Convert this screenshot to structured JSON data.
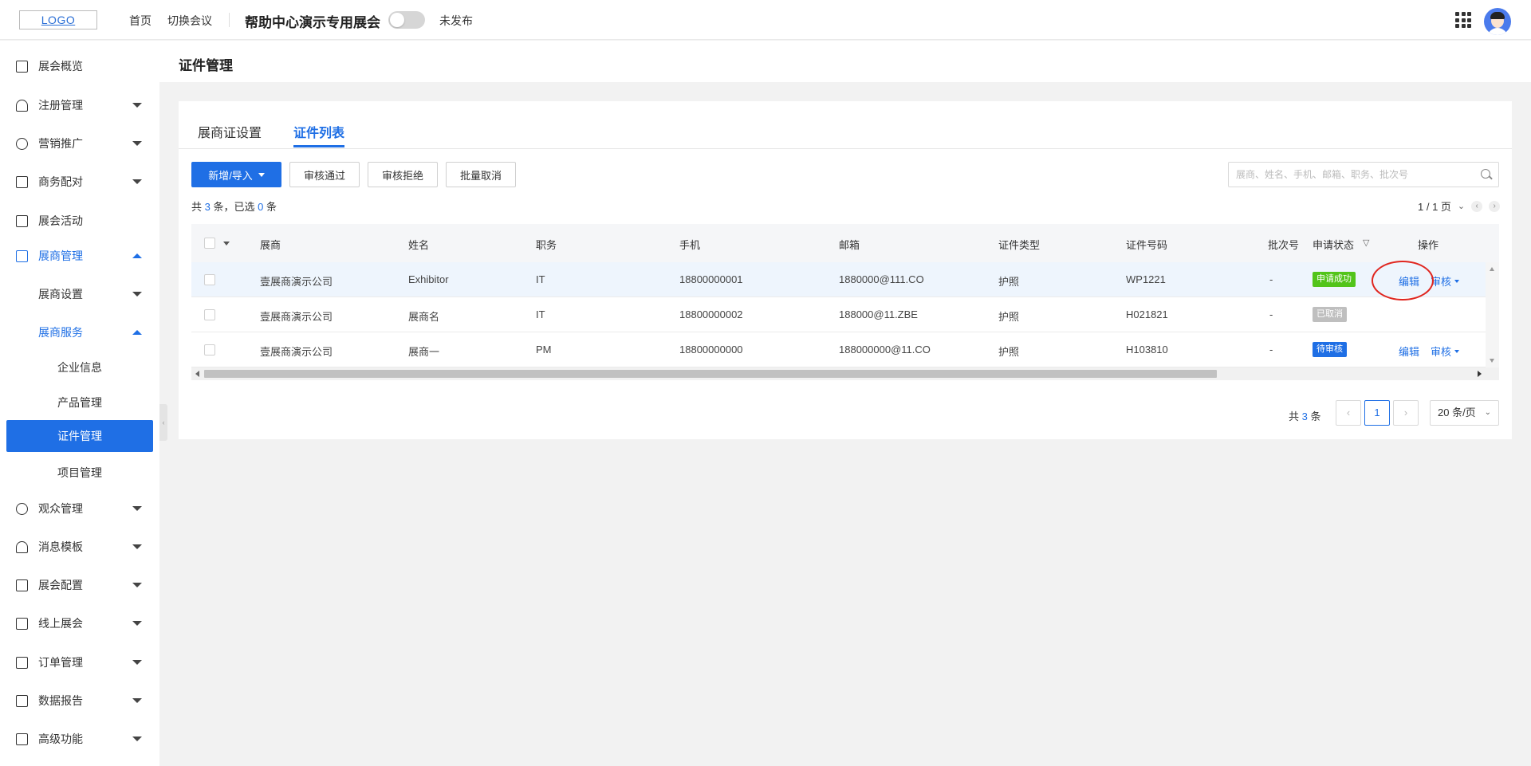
{
  "topbar": {
    "logo": "LOGO",
    "nav_home": "首页",
    "nav_switch": "切换会议",
    "expo_title": "帮助中心演示专用展会",
    "publish_status": "未发布"
  },
  "sidebar": {
    "items": [
      {
        "label": "展会概览"
      },
      {
        "label": "注册管理"
      },
      {
        "label": "营销推广"
      },
      {
        "label": "商务配对"
      },
      {
        "label": "展会活动"
      },
      {
        "label": "展商管理"
      },
      {
        "label": "展商设置"
      },
      {
        "label": "展商服务"
      },
      {
        "label": "企业信息"
      },
      {
        "label": "产品管理"
      },
      {
        "label": "证件管理"
      },
      {
        "label": "项目管理"
      },
      {
        "label": "观众管理"
      },
      {
        "label": "消息模板"
      },
      {
        "label": "展会配置"
      },
      {
        "label": "线上展会"
      },
      {
        "label": "订单管理"
      },
      {
        "label": "数据报告"
      },
      {
        "label": "高级功能"
      }
    ]
  },
  "page": {
    "title": "证件管理",
    "tabs": [
      {
        "label": "展商证设置"
      },
      {
        "label": "证件列表"
      }
    ]
  },
  "toolbar": {
    "add_import": "新增/导入",
    "approve": "审核通过",
    "reject": "审核拒绝",
    "batch_cancel": "批量取消",
    "search_placeholder": "展商、姓名、手机、邮箱、职务、批次号"
  },
  "summary": {
    "prefix": "共",
    "total": "3",
    "mid": "条，已选",
    "selected": "0",
    "suffix": "条",
    "mini_pager": "1 / 1 页"
  },
  "table": {
    "columns": [
      "展商",
      "姓名",
      "职务",
      "手机",
      "邮箱",
      "证件类型",
      "证件号码",
      "批次号",
      "申请状态",
      "操作"
    ],
    "rows": [
      {
        "exhibitor": "壹展商演示公司",
        "name": "Exhibitor",
        "position": "IT",
        "phone": "18800000001",
        "email": "1880000@111.CO",
        "cert_type": "护照",
        "cert_no": "WP1221",
        "batch": "-",
        "status": "申请成功",
        "edit": "编辑",
        "audit": "审核"
      },
      {
        "exhibitor": "壹展商演示公司",
        "name": "展商名",
        "position": "IT",
        "phone": "18800000002",
        "email": "188000@11.ZBE",
        "cert_type": "护照",
        "cert_no": "H021821",
        "batch": "-",
        "status": "已取消"
      },
      {
        "exhibitor": "壹展商演示公司",
        "name": "展商一",
        "position": "PM",
        "phone": "18800000000",
        "email": "188000000@11.CO",
        "cert_type": "护照",
        "cert_no": "H103810",
        "batch": "-",
        "status": "待审核",
        "edit": "编辑",
        "audit": "审核"
      }
    ]
  },
  "pagination": {
    "prefix": "共",
    "total": "3",
    "suffix": "条",
    "current": "1",
    "page_size": "20 条/页"
  },
  "colors": {
    "accent": "#1f6fe5",
    "success": "#52c41a",
    "cancelled": "#bfbfbf",
    "highlight": "#e0261f"
  }
}
